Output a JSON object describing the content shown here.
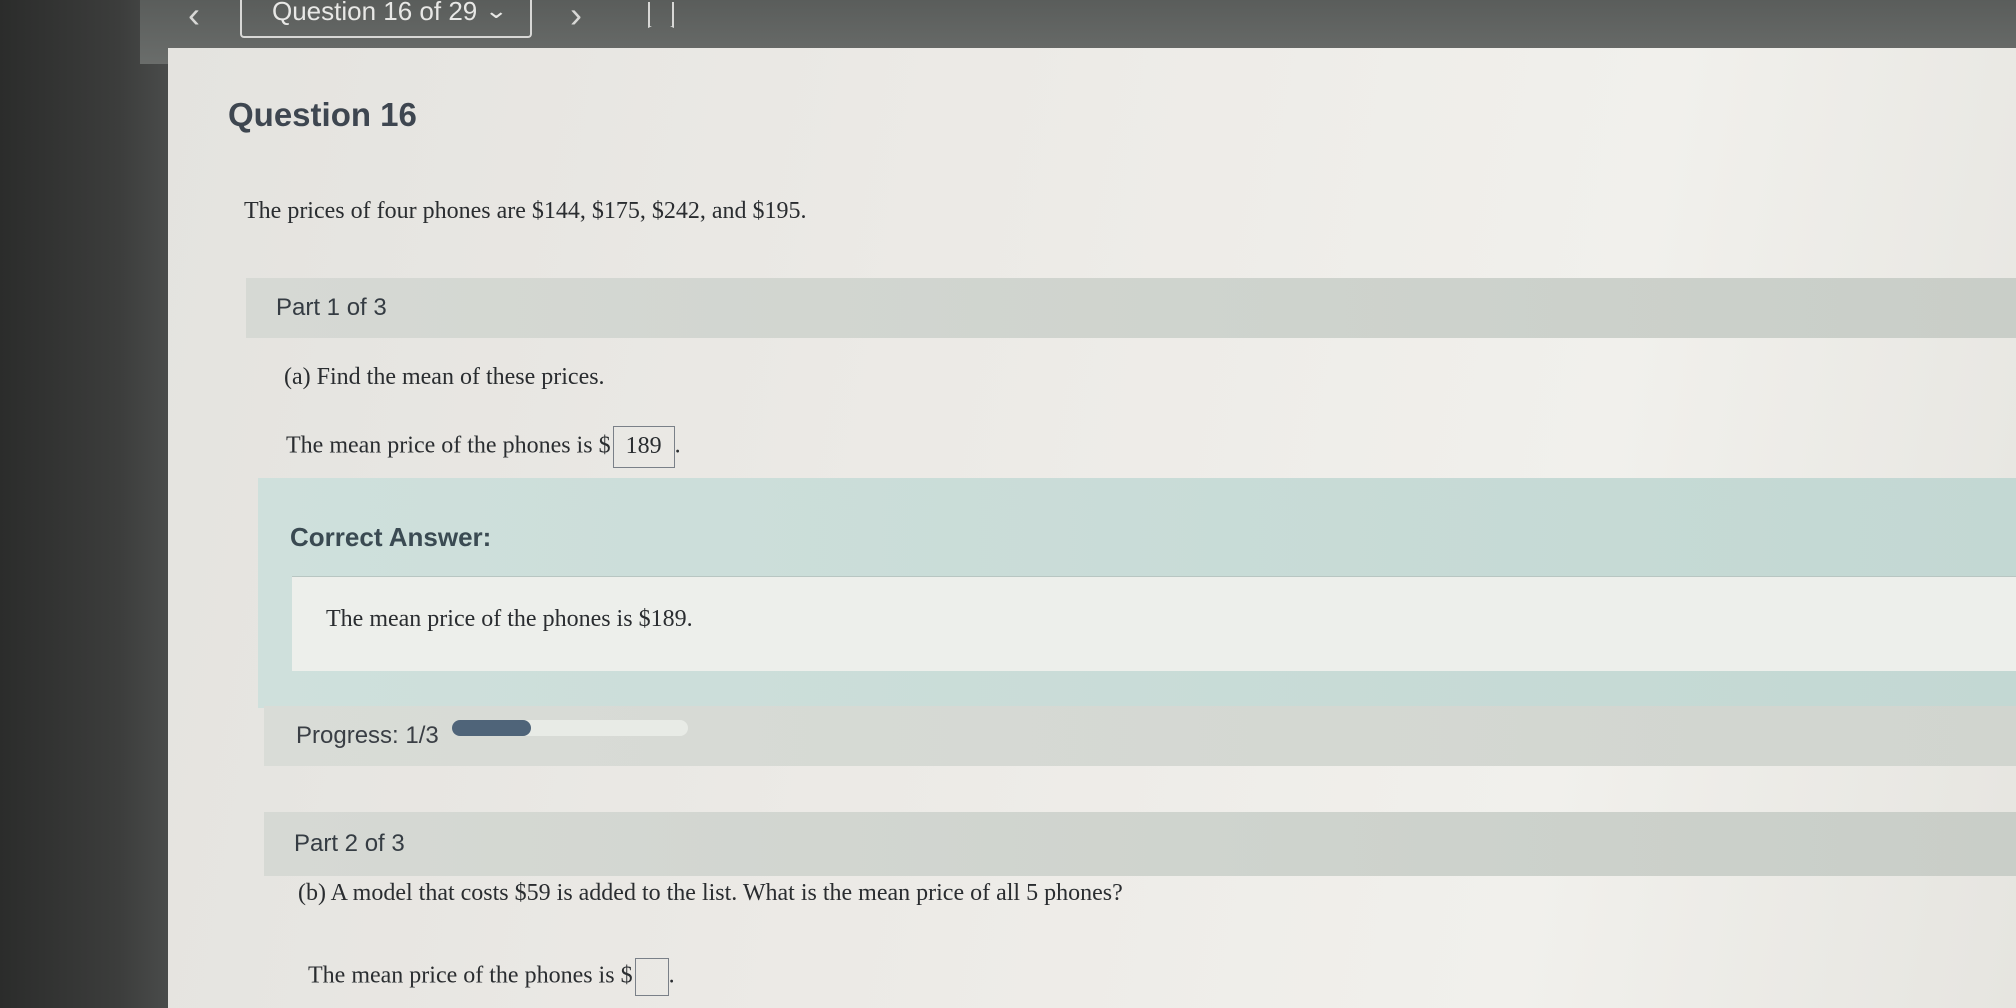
{
  "nav": {
    "question_select_label": "Question 16 of 29",
    "prev_icon": "chevron-left-icon",
    "next_icon": "chevron-right-icon",
    "bookmark_icon": "bookmark-icon"
  },
  "question": {
    "title": "Question 16",
    "text": "The prices of four phones are $144, $175, $242, and $195."
  },
  "part1": {
    "header": "Part 1 of 3",
    "prompt": "(a) Find the mean of these prices.",
    "answer_prefix": "The mean price of the phones is $",
    "answer_value": "189",
    "answer_suffix": "."
  },
  "correct": {
    "title": "Correct Answer:",
    "text": "The mean price of the phones is $189."
  },
  "progress": {
    "label": "Progress: 1/3",
    "fraction": 0.3333
  },
  "part2": {
    "header": "Part 2 of 3",
    "prompt": "(b) A model that costs $59 is added to the list. What is the mean price of all 5 phones?",
    "answer_prefix": "The mean price of the phones is $",
    "answer_value": "",
    "answer_suffix": "."
  },
  "colors": {
    "progress_fill": "#4f6479",
    "correct_panel": "#c3d8d3",
    "title_text": "#3e4650"
  }
}
